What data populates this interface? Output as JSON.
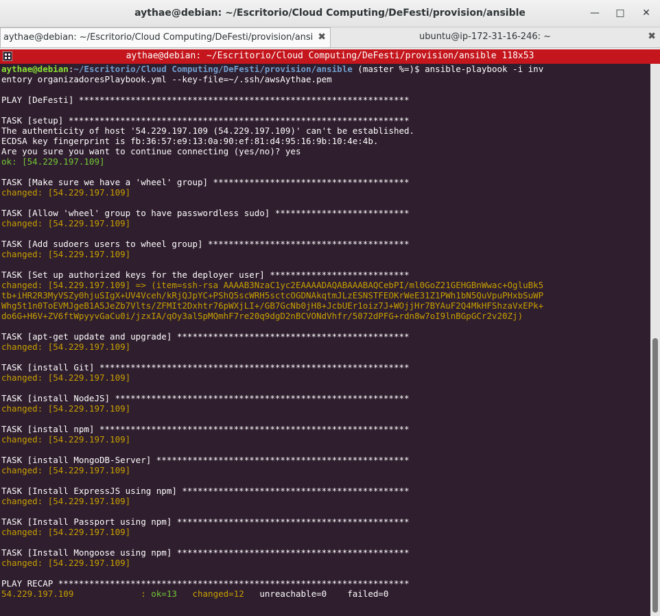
{
  "window": {
    "title": "aythae@debian: ~/Escritorio/Cloud Computing/DeFesti/provision/ansible"
  },
  "tabs": [
    {
      "label": "aythae@debian: ~/Escritorio/Cloud Computing/DeFesti/provision/ansib",
      "active": true
    },
    {
      "label": "ubuntu@ip-172-31-16-246: ~",
      "active": false
    }
  ],
  "terminal": {
    "header": "aythae@debian: ~/Escritorio/Cloud Computing/DeFesti/provision/ansible 118x53",
    "prompt": {
      "user": "aythae@debian",
      "path": "~/Escritorio/Cloud Computing/DeFesti/provision/ansible",
      "git": " (master %=)$ ",
      "cmd": "ansible-playbook -i inv",
      "cmd2": "entory organizadoresPlaybook.yml --key-file=~/.ssh/awsAythae.pem"
    },
    "play": "PLAY [DeFesti] ****************************************************************",
    "task_setup": "TASK [setup] ******************************************************************",
    "auth1": "The authenticity of host '54.229.197.109 (54.229.197.109)' can't be established.",
    "auth2": "ECDSA key fingerprint is fb:36:57:e9:13:0a:90:ef:81:d4:95:16:9b:10:4e:4b.",
    "auth3": "Are you sure you want to continue connecting (yes/no)? yes",
    "ok_setup": "ok: [54.229.197.109]",
    "task_wheel": "TASK [Make sure we have a 'wheel' group] **************************************",
    "task_sudo": "TASK [Allow 'wheel' group to have passwordless sudo] **************************",
    "task_sudoers": "TASK [Add sudoers users to wheel group] ***************************************",
    "task_keys": "TASK [Set up authorized keys for the deployer user] ***************************",
    "keys1": "changed: [54.229.197.109] => (item=ssh-rsa AAAAB3NzaC1yc2EAAAADAQABAAABAQCebPI/ml0GoZ21GEHGBnWwac+OgluBk5",
    "keys2": "tb+iHR2R3MyVSZy0hjuSIgX+UV4Vceh/kRjQJpYC+PShQ5scWRH5sctcOGDNAkqtmJLzESNSTFEOKrWeE31Z1PWh1bN5QuVpuPHxbSuWP",
    "keys3": "Whg5t1n0ToEVMJgeB1A5JeZb7Vlts/ZFMIt2Dxhtr76pWXjLI+/GB7GcNb0jH8+JcbUEr1oiz7J+WOjjHr7BYAuF2Q4MkHFShzaVxEPk+",
    "keys4": "do6G+H6V+ZV6ftWpyyvGaCu0i/jzxIA/qOy3alSpMQmhF7re20q9dgD2nBCVONdVhfr/5072dPFG+rdn8w7oI9lnBGpGCr2v20Zj)",
    "task_apt": "TASK [apt-get update and upgrade] *********************************************",
    "task_git": "TASK [install Git] ************************************************************",
    "task_node": "TASK [install NodeJS] *********************************************************",
    "task_npm": "TASK [install npm] ************************************************************",
    "task_mongo": "TASK [install MongoDB-Server] *************************************************",
    "task_express": "TASK [Install ExpressJS using npm] ********************************************",
    "task_passport": "TASK [Install Passport using npm] *********************************************",
    "task_mongoose": "TASK [Install Mongoose using npm] *********************************************",
    "changed": "changed: [54.229.197.109]",
    "recap": "PLAY RECAP ********************************************************************",
    "recap_host": "54.229.197.109             : ",
    "recap_ok": "ok=13",
    "recap_changed": "changed=12",
    "recap_rest": "unreachable=0    failed=0"
  }
}
